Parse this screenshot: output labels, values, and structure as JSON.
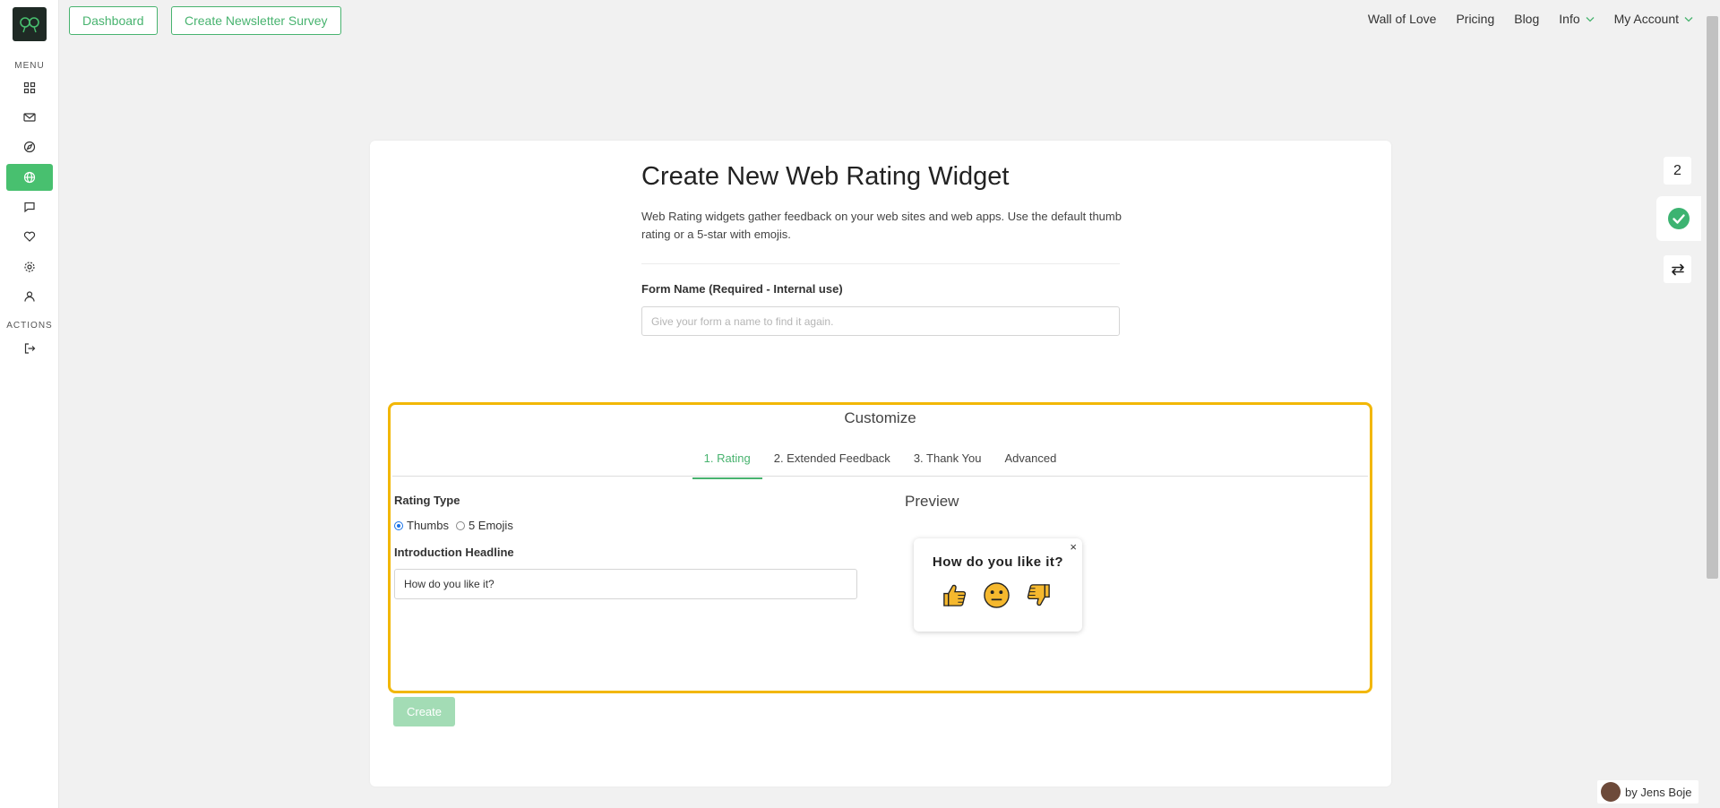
{
  "sidebar": {
    "menu_label": "MENU",
    "actions_label": "ACTIONS",
    "items": [
      {
        "icon": "grid-icon"
      },
      {
        "icon": "mail-icon"
      },
      {
        "icon": "compass-icon"
      },
      {
        "icon": "globe-icon",
        "active": true
      },
      {
        "icon": "chat-icon"
      },
      {
        "icon": "heart-icon"
      },
      {
        "icon": "gear-icon"
      },
      {
        "icon": "user-icon"
      }
    ],
    "logout_icon": "logout-icon"
  },
  "topbar": {
    "dashboard_label": "Dashboard",
    "newsletter_label": "Create Newsletter Survey",
    "nav": {
      "wall": "Wall of Love",
      "pricing": "Pricing",
      "blog": "Blog",
      "info": "Info",
      "account": "My Account"
    }
  },
  "main": {
    "title": "Create New Web Rating Widget",
    "description": "Web Rating widgets gather feedback on your web sites and web apps. Use the default thumb rating or a 5-star with emojis.",
    "form_name_label": "Form Name (Required - Internal use)",
    "form_name_placeholder": "Give your form a name to find it again.",
    "form_name_value": ""
  },
  "customize": {
    "title": "Customize",
    "tabs": [
      "1. Rating",
      "2. Extended Feedback",
      "3. Thank You",
      "Advanced"
    ],
    "active_tab": 0,
    "rating_type_label": "Rating Type",
    "rating_options": [
      "Thumbs",
      "5 Emojis"
    ],
    "selected_rating": "Thumbs",
    "headline_label": "Introduction Headline",
    "headline_value": "How do you like it?",
    "preview_label": "Preview",
    "preview_close": "×",
    "preview_question": "How do you like it?"
  },
  "create_label": "Create",
  "floating": {
    "count": "2"
  },
  "credit": "by Jens Boje",
  "colors": {
    "accent": "#48b36f",
    "highlight": "#f2b705",
    "emoji": "#f5b82e"
  }
}
